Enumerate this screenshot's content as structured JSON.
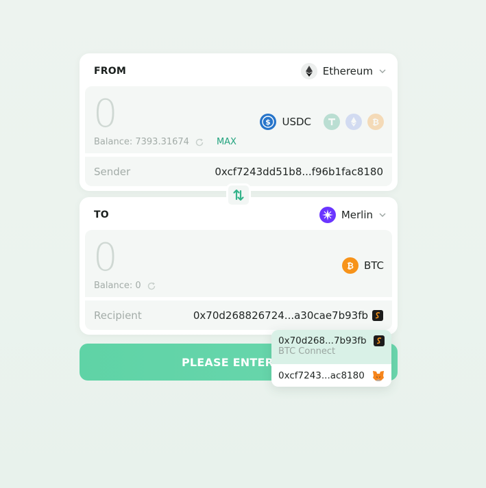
{
  "from": {
    "title": "FROM",
    "chain": "Ethereum",
    "amount": "0",
    "balance": "Balance: 7393.31674",
    "max_label": "MAX",
    "token": "USDC",
    "address_label": "Sender",
    "address": "0xcf7243dd51b8...f96b1fac8180"
  },
  "to": {
    "title": "TO",
    "chain": "Merlin",
    "amount": "0",
    "balance": "Balance: 0",
    "token": "BTC",
    "address_label": "Recipient",
    "address": "0x70d268826724...a30cae7b93fb"
  },
  "submit_label": "PLEASE ENTER AN",
  "wallet_dropdown": [
    {
      "address": "0x70d268...7b93fb",
      "wallet": "BTC Connect",
      "icon": "btc-connect-icon"
    },
    {
      "address": "0xcf7243...ac8180",
      "icon": "metamask-icon"
    }
  ],
  "colors": {
    "accent": "#22a37e",
    "button": "#62d4a9",
    "usdc": "#2775ca",
    "btc": "#f7931a",
    "merlin": "#6a35ff"
  }
}
